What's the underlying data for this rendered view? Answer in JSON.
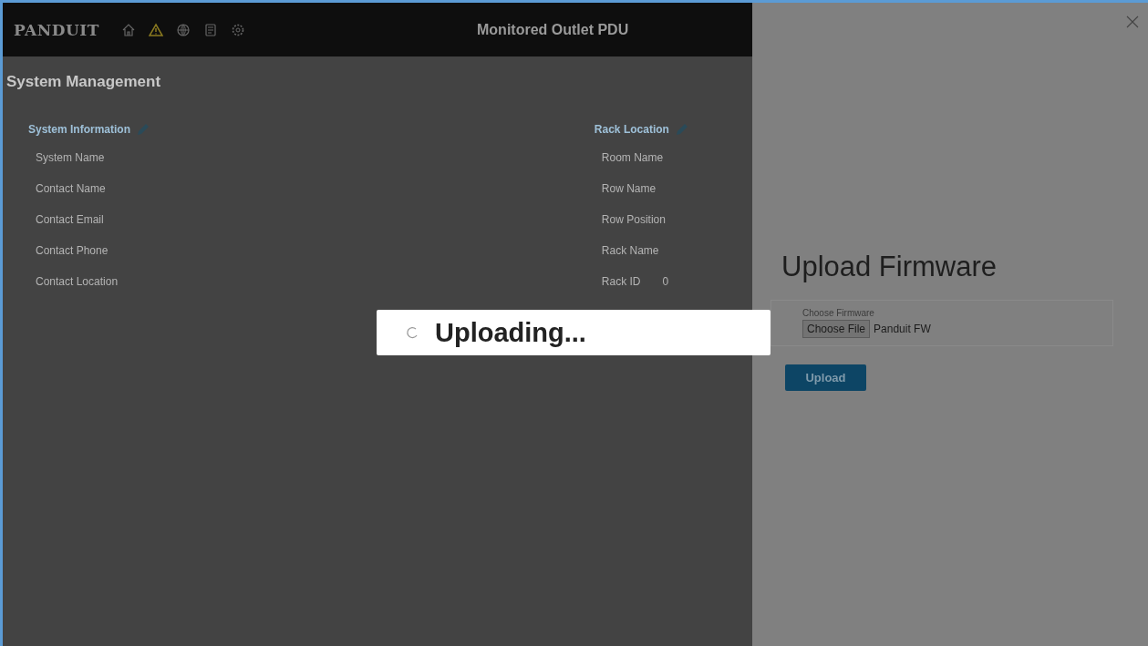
{
  "header": {
    "logo": "PANDUIT",
    "title": "Monitored Outlet PDU"
  },
  "page_title": "System Management",
  "sections": [
    {
      "title": "System Information",
      "fields": [
        {
          "label": "System Name"
        },
        {
          "label": "Contact Name"
        },
        {
          "label": "Contact Email"
        },
        {
          "label": "Contact Phone"
        },
        {
          "label": "Contact Location"
        }
      ]
    },
    {
      "title": "Rack Location",
      "fields": [
        {
          "label": "Room Name"
        },
        {
          "label": "Row Name"
        },
        {
          "label": "Row Position"
        },
        {
          "label": "Rack Name"
        },
        {
          "label": "Rack ID",
          "value": "0"
        }
      ]
    }
  ],
  "toast": {
    "message": "Uploading..."
  },
  "panel": {
    "title": "Upload Firmware",
    "field_label": "Choose Firmware",
    "file_button": "Choose File",
    "file_name": "Panduit FW",
    "submit": "Upload"
  }
}
